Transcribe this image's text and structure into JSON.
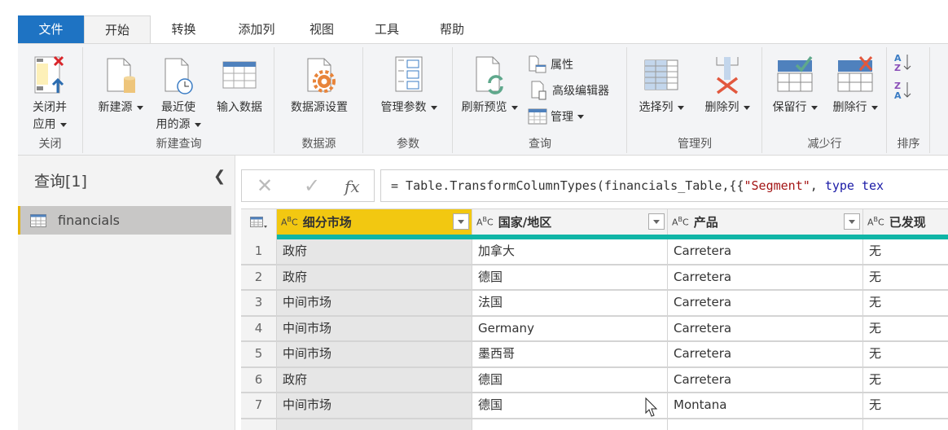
{
  "tabs": [
    "文件",
    "开始",
    "转换",
    "添加列",
    "视图",
    "工具",
    "帮助"
  ],
  "active_tab": "开始",
  "ribbon": {
    "groups": [
      {
        "label": "关闭",
        "buttons": [
          {
            "label_line1": "关闭并",
            "label_line2": "应用",
            "icon": "close-apply-icon",
            "dropdown": true
          }
        ]
      },
      {
        "label": "新建查询",
        "buttons": [
          {
            "label_line1": "新建源",
            "icon": "new-source-icon",
            "dropdown": true
          },
          {
            "label_line1": "最近使",
            "label_line2": "用的源",
            "icon": "recent-sources-icon",
            "dropdown": true
          },
          {
            "label_line1": "输入数据",
            "icon": "enter-data-icon",
            "dropdown": false
          }
        ]
      },
      {
        "label": "数据源",
        "buttons": [
          {
            "label_line1": "数据源设置",
            "icon": "data-source-settings-icon",
            "dropdown": false
          }
        ]
      },
      {
        "label": "参数",
        "buttons": [
          {
            "label_line1": "管理参数",
            "icon": "manage-parameters-icon",
            "dropdown": true
          }
        ]
      },
      {
        "label": "查询",
        "buttons": [
          {
            "label_line1": "刷新预览",
            "icon": "refresh-preview-icon",
            "dropdown": true
          },
          {
            "label_line1": "属性",
            "icon": "properties-icon",
            "dropdown": false
          },
          {
            "label_line1": "高级编辑器",
            "icon": "advanced-editor-icon",
            "dropdown": false
          },
          {
            "label_line1": "管理",
            "icon": "manage-icon",
            "dropdown": true
          }
        ]
      },
      {
        "label": "管理列",
        "buttons": [
          {
            "label_line1": "选择列",
            "icon": "choose-columns-icon",
            "dropdown": true
          },
          {
            "label_line1": "删除列",
            "icon": "remove-columns-icon",
            "dropdown": true
          }
        ]
      },
      {
        "label": "减少行",
        "buttons": [
          {
            "label_line1": "保留行",
            "icon": "keep-rows-icon",
            "dropdown": true
          },
          {
            "label_line1": "删除行",
            "icon": "remove-rows-icon",
            "dropdown": true
          }
        ]
      },
      {
        "label": "排序",
        "buttons": [
          {
            "icon": "sort-ascending-icon"
          },
          {
            "icon": "sort-descending-icon"
          }
        ]
      }
    ]
  },
  "queries": {
    "title": "查询[1]",
    "items": [
      {
        "name": "financials",
        "selected": true
      }
    ]
  },
  "formula_bar": {
    "prefix": "= Table.TransformColumnTypes(financials_Table,{{",
    "string": "\"Segment\"",
    "sep": ", ",
    "keyword": "type",
    "rest": " tex"
  },
  "grid": {
    "columns": [
      {
        "type": "ABC",
        "name": "细分市场",
        "selected": true
      },
      {
        "type": "ABC",
        "name": "国家/地区",
        "selected": false
      },
      {
        "type": "ABC",
        "name": "产品",
        "selected": false
      },
      {
        "type": "ABC",
        "name": "已发现",
        "selected": false
      }
    ],
    "rows": [
      [
        "1",
        "政府",
        "加拿大",
        "Carretera",
        "无"
      ],
      [
        "2",
        "政府",
        "德国",
        "Carretera",
        "无"
      ],
      [
        "3",
        "中间市场",
        "法国",
        "Carretera",
        "无"
      ],
      [
        "4",
        "中间市场",
        "Germany",
        "Carretera",
        "无"
      ],
      [
        "5",
        "中间市场",
        "墨西哥",
        "Carretera",
        "无"
      ],
      [
        "6",
        "政府",
        "德国",
        "Carretera",
        "无"
      ],
      [
        "7",
        "中间市场",
        "德国",
        "Montana",
        "无"
      ]
    ]
  },
  "colors": {
    "file_tab": "#1e73c3",
    "selected_column": "#f2c811",
    "quality_bar": "#10b5a6",
    "query_accent": "#e8b400"
  }
}
